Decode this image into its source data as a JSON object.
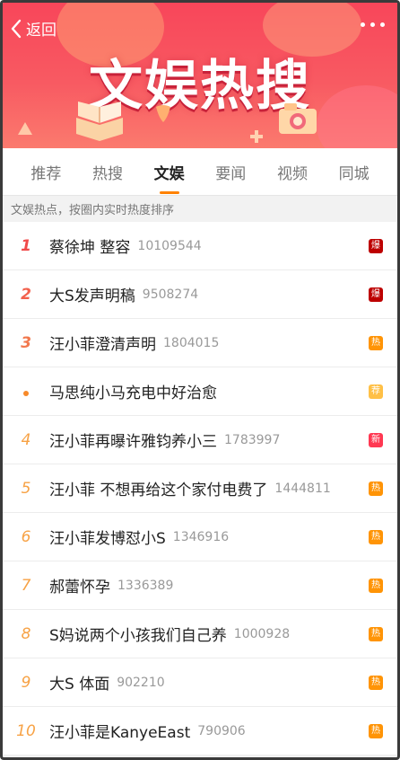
{
  "nav": {
    "back_label": "返回"
  },
  "banner": {
    "title": "文娱热搜"
  },
  "tabs": [
    {
      "label": "推荐",
      "active": false
    },
    {
      "label": "热搜",
      "active": false
    },
    {
      "label": "文娱",
      "active": true
    },
    {
      "label": "要闻",
      "active": false
    },
    {
      "label": "视频",
      "active": false
    },
    {
      "label": "同城",
      "active": false
    }
  ],
  "info_text": "文娱热点，按圈内实时热度排序",
  "items": [
    {
      "rank": "1",
      "title": "蔡徐坤 整容",
      "count": "10109544",
      "badge": "爆"
    },
    {
      "rank": "2",
      "title": "大S发声明稿",
      "count": "9508274",
      "badge": "爆"
    },
    {
      "rank": "3",
      "title": "汪小菲澄清声明",
      "count": "1804015",
      "badge": "热"
    },
    {
      "rank": "",
      "title": "马思纯小马充电中好治愈",
      "count": "",
      "badge": "荐"
    },
    {
      "rank": "4",
      "title": "汪小菲再曝许雅钧养小三",
      "count": "1783997",
      "badge": "新"
    },
    {
      "rank": "5",
      "title": "汪小菲 不想再给这个家付电费了",
      "count": "1444811",
      "badge": "热"
    },
    {
      "rank": "6",
      "title": "汪小菲发博怼小S",
      "count": "1346916",
      "badge": "热"
    },
    {
      "rank": "7",
      "title": "郝蕾怀孕",
      "count": "1336389",
      "badge": "热"
    },
    {
      "rank": "8",
      "title": "S妈说两个小孩我们自己养",
      "count": "1000928",
      "badge": "热"
    },
    {
      "rank": "9",
      "title": "大S 体面",
      "count": "902210",
      "badge": "热"
    },
    {
      "rank": "10",
      "title": "汪小菲是KanyeEast",
      "count": "790906",
      "badge": "热"
    }
  ],
  "colors": {
    "accent": "#ff8200",
    "banner": "#f8465a",
    "badge_bao": "#bd0000",
    "badge_re": "#ff9406",
    "badge_jian": "#ffc046",
    "badge_xin": "#ff3852"
  }
}
